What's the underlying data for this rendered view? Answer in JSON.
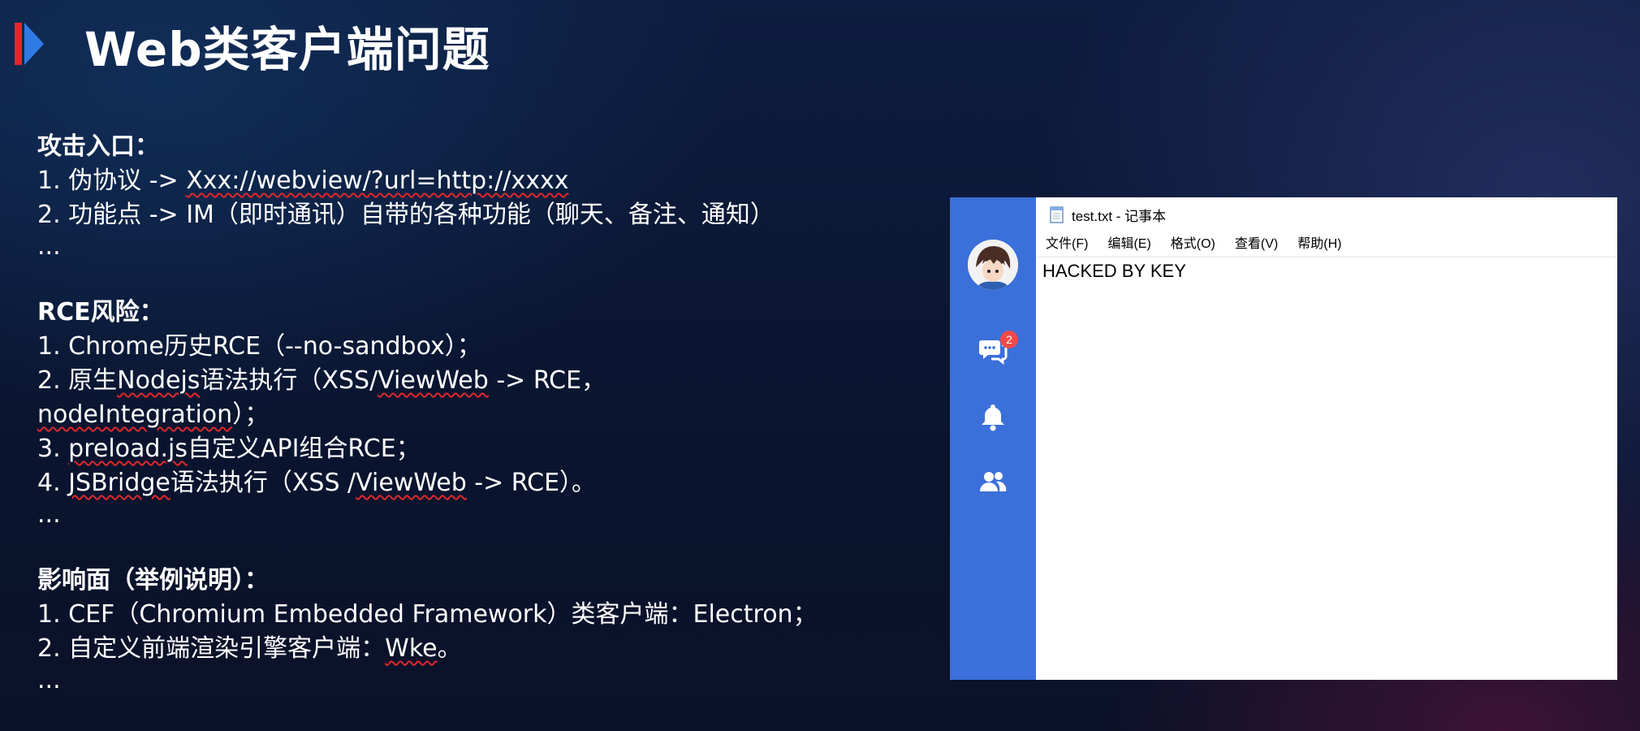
{
  "slide": {
    "title": "Web类客户端问题",
    "accent_colors": [
      "#e0282a",
      "#2f7ae5"
    ]
  },
  "sections": {
    "entry": {
      "heading": "攻击入口：",
      "l1_prefix": "1. 伪协议 -> ",
      "l1_link": "Xxx://webview/?url=http://xxxx",
      "l2": "2. 功能点 -> IM（即时通讯）自带的各种功能（聊天、备注、通知）",
      "more": "..."
    },
    "rce": {
      "heading": "RCE风险：",
      "l1": "1. Chrome历史RCE（--no-sandbox）；",
      "l2_a": "2. 原生",
      "l2_b": "Nodejs",
      "l2_c": "语法执行（XSS/",
      "l2_d": "ViewWeb",
      "l2_e": " -> RCE，",
      "l2_f": "nodeIntegration",
      "l2_g": "）；",
      "l3_a": "3. ",
      "l3_b": "preload.js",
      "l3_c": "自定义API组合RCE；",
      "l4_a": "4. ",
      "l4_b": "JSBridge",
      "l4_c": "语法执行（XSS /",
      "l4_d": "ViewWeb",
      "l4_e": " -> RCE）。",
      "more": "..."
    },
    "impact": {
      "heading": "影响面（举例说明）：",
      "l1": "1.   CEF（Chromium Embedded Framework）类客户端：Electron；",
      "l2_a": "2.   自定义前端渲染引擎客户端：",
      "l2_b": "Wke",
      "l2_c": "。",
      "more": "..."
    }
  },
  "screenshot": {
    "sidebar": {
      "color": "#3b6fd9",
      "chat_badge": "2",
      "icons": [
        "avatar",
        "chat-icon",
        "bell-icon",
        "contacts-icon"
      ]
    },
    "notepad": {
      "window_title": "test.txt - 记事本",
      "menu": [
        "文件(F)",
        "编辑(E)",
        "格式(O)",
        "查看(V)",
        "帮助(H)"
      ],
      "content": "HACKED BY KEY"
    }
  }
}
